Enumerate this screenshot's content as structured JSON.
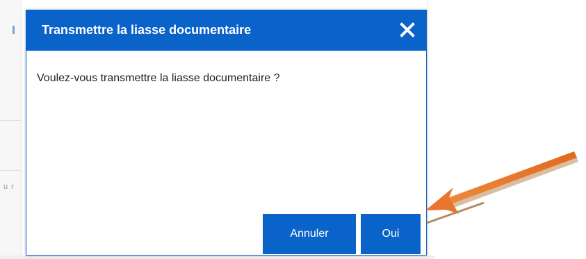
{
  "dialog": {
    "title": "Transmettre la liasse documentaire",
    "message": "Voulez-vous transmettre la liasse documentaire ?",
    "close_icon": "close-icon",
    "buttons": {
      "cancel_label": "Annuler",
      "confirm_label": "Oui"
    }
  },
  "background": {
    "text_fragment": "u r"
  },
  "annotation": {
    "arrow_icon": "arrow-pointer-icon",
    "color": "#e8762c"
  },
  "colors": {
    "primary": "#0a63c8",
    "header_text": "#ffffff",
    "message_text": "#222222"
  }
}
